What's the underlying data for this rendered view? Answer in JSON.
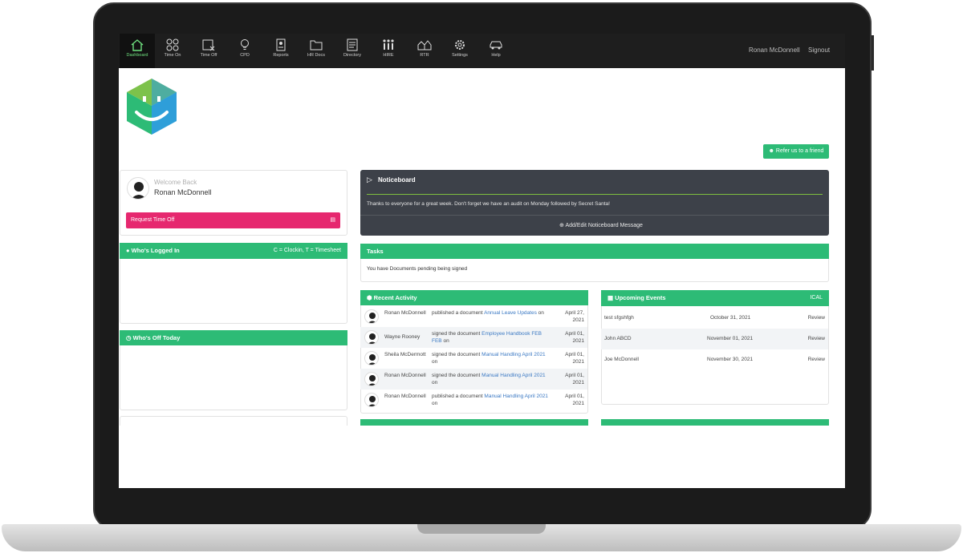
{
  "nav": {
    "items": [
      {
        "label": "Dashboard",
        "icon": "home-icon"
      },
      {
        "label": "Time On",
        "icon": "clock-grid-icon"
      },
      {
        "label": "Time Off",
        "icon": "calendar-off-icon"
      },
      {
        "label": "CPD",
        "icon": "lightbulb-icon"
      },
      {
        "label": "Reports",
        "icon": "report-icon"
      },
      {
        "label": "HR Docs",
        "icon": "folder-icon"
      },
      {
        "label": "Directory",
        "icon": "directory-icon"
      },
      {
        "label": "HIRE",
        "icon": "people-grid-icon"
      },
      {
        "label": "RTR",
        "icon": "houses-icon"
      },
      {
        "label": "Settings",
        "icon": "gear-icon"
      },
      {
        "label": "Help",
        "icon": "car-icon"
      }
    ],
    "user_name": "Ronan McDonnell",
    "signout": "Signout"
  },
  "refer_button": "Refer us to a friend",
  "welcome": {
    "greeting": "Welcome Back",
    "name": "Ronan McDonnell"
  },
  "request_time_off": "Request Time Off",
  "logged_in": {
    "title": "Who's Logged In",
    "legend": "C = Clockin, T = Timesheet"
  },
  "off_today": {
    "title": "Who's Off Today"
  },
  "noticeboard": {
    "title": "Noticeboard",
    "message": "Thanks to everyone for a great week. Don't forget we have an audit on Monday followed by Secret Santa!",
    "add_label": "Add/Edit Noticeboard Message"
  },
  "tasks": {
    "title": "Tasks",
    "message": "You have Documents pending being signed"
  },
  "recent_activity": {
    "title": "Recent Activity",
    "rows": [
      {
        "who": "Ronan McDonnell",
        "action": "published a document",
        "doc": "Annual Leave Updates",
        "suffix": "on",
        "date": "April 27, 2021"
      },
      {
        "who": "Wayne Rooney",
        "action": "signed the document",
        "doc": "Employee Handbook FEB FEB",
        "suffix": "on",
        "date": "April 01, 2021"
      },
      {
        "who": "Sheila McDermott",
        "action": "signed the document",
        "doc": "Manual Handling April 2021",
        "suffix": "on",
        "date": "April 01, 2021"
      },
      {
        "who": "Ronan McDonnell",
        "action": "signed the document",
        "doc": "Manual Handling April 2021",
        "suffix": "on",
        "date": "April 01, 2021"
      },
      {
        "who": "Ronan McDonnell",
        "action": "published a document",
        "doc": "Manual Handling April 2021",
        "suffix": "on",
        "date": "April 01, 2021"
      }
    ]
  },
  "upcoming_events": {
    "title": "Upcoming Events",
    "ical": "ICAL",
    "rows": [
      {
        "name": "test sfgshfgh",
        "date": "October 31, 2021",
        "action": "Review"
      },
      {
        "name": "John ABCD",
        "date": "November 01, 2021",
        "action": "Review"
      },
      {
        "name": "Joe McDonnell",
        "date": "November 30, 2021",
        "action": "Review"
      }
    ]
  },
  "colors": {
    "accent_green": "#2dbb76",
    "pink": "#e6286f",
    "nav_bg": "#1e1e1e",
    "notice_bg": "#3d4149",
    "link_blue": "#3a78c3"
  }
}
